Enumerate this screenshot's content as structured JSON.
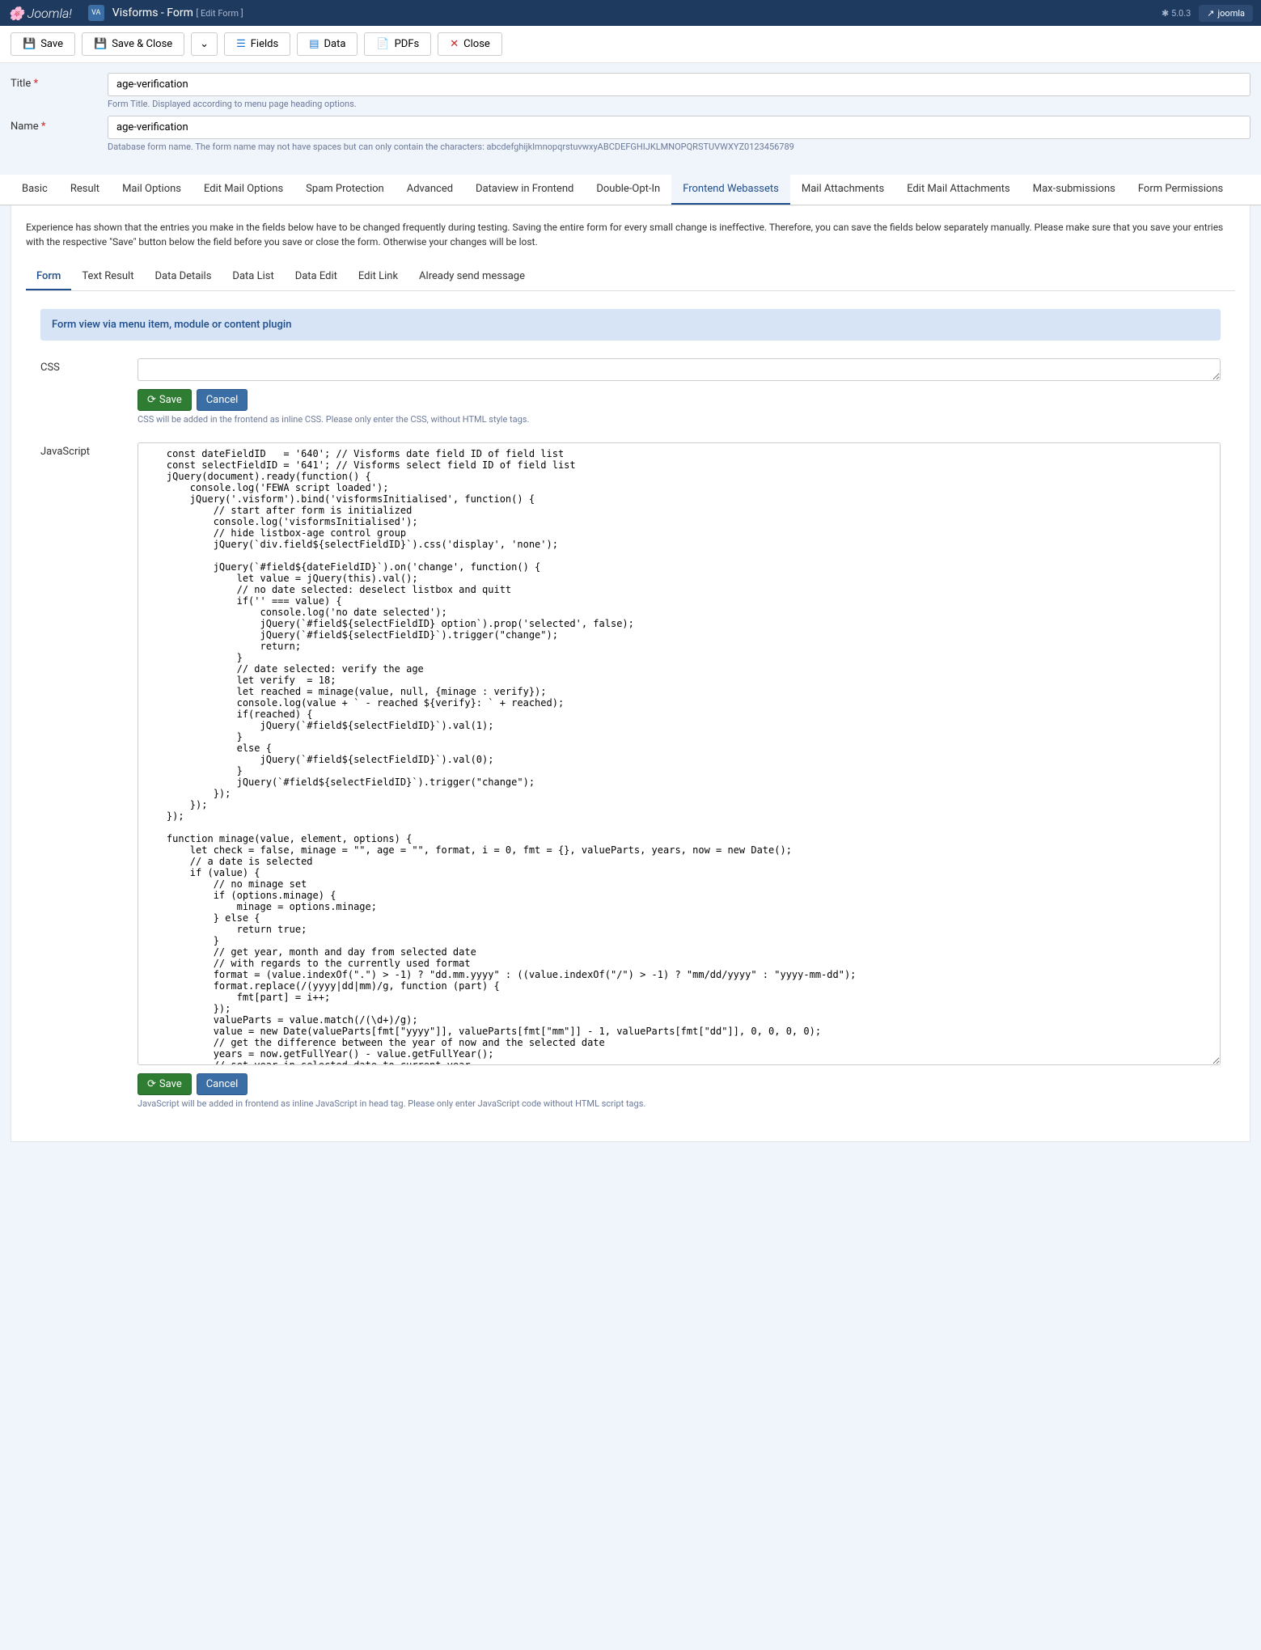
{
  "header": {
    "logo": "Joomla!",
    "appLabel": "VA",
    "breadcrumb": "Visforms - Form",
    "breadcrumbSub": "[ Edit Form ]",
    "version": "5.0.3",
    "user": "joomla"
  },
  "toolbar": {
    "save": "Save",
    "saveClose": "Save & Close",
    "fields": "Fields",
    "data": "Data",
    "pdfs": "PDFs",
    "close": "Close"
  },
  "titleField": {
    "label": "Title",
    "value": "age-verification",
    "help": "Form Title. Displayed according to menu page heading options."
  },
  "nameField": {
    "label": "Name",
    "value": "age-verification",
    "help": "Database form name. The form name may not have spaces but can only contain the characters: abcdefghijklmnopqrstuvwxyABCDEFGHIJKLMNOPQRSTUVWXYZ0123456789"
  },
  "mainTabs": [
    "Basic",
    "Result",
    "Mail Options",
    "Edit Mail Options",
    "Spam Protection",
    "Advanced",
    "Dataview in Frontend",
    "Double-Opt-In",
    "Frontend Webassets",
    "Mail Attachments",
    "Edit Mail Attachments",
    "Max-submissions",
    "Form Permissions"
  ],
  "mainTabActive": 8,
  "notice": "Experience has shown that the entries you make in the fields below have to be changed frequently during testing. Saving the entire form for every small change is ineffective. Therefore, you can save the fields below separately manually. Please make sure that you save your entries with the respective \"Save\" button below the field before you save or close the form. Otherwise your changes will be lost.",
  "subTabs": [
    "Form",
    "Text Result",
    "Data Details",
    "Data List",
    "Data Edit",
    "Edit Link",
    "Already send message"
  ],
  "subTabActive": 0,
  "banner": "Form view via menu item, module or content plugin",
  "cssSection": {
    "label": "CSS",
    "saveBtn": "Save",
    "cancelBtn": "Cancel",
    "help": "CSS will be added in the frontend as inline CSS. Please only enter the CSS, without HTML style tags."
  },
  "jsSection": {
    "label": "JavaScript",
    "saveBtn": "Save",
    "cancelBtn": "Cancel",
    "help": "JavaScript will be added in frontend as inline JavaScript in head tag. Please only enter JavaScript code without HTML script tags.",
    "code": "    const dateFieldID   = '640'; // Visforms date field ID of field list\n    const selectFieldID = '641'; // Visforms select field ID of field list\n    jQuery(document).ready(function() {\n        console.log('FEWA script loaded');\n        jQuery('.visform').bind('visformsInitialised', function() {\n            // start after form is initialized\n            console.log('visformsInitialised');\n            // hide listbox-age control group\n            jQuery(`div.field${selectFieldID}`).css('display', 'none');\n\n            jQuery(`#field${dateFieldID}`).on('change', function() {\n                let value = jQuery(this).val();\n                // no date selected: deselect listbox and quitt\n                if('' === value) {\n                    console.log('no date selected');\n                    jQuery(`#field${selectFieldID} option`).prop('selected', false);\n                    jQuery(`#field${selectFieldID}`).trigger(\"change\");\n                    return;\n                }\n                // date selected: verify the age\n                let verify  = 18;\n                let reached = minage(value, null, {minage : verify});\n                console.log(value + ` - reached ${verify}: ` + reached);\n                if(reached) {\n                    jQuery(`#field${selectFieldID}`).val(1);\n                }\n                else {\n                    jQuery(`#field${selectFieldID}`).val(0);\n                }\n                jQuery(`#field${selectFieldID}`).trigger(\"change\");\n            });\n        });\n    });\n\n    function minage(value, element, options) {\n        let check = false, minage = \"\", age = \"\", format, i = 0, fmt = {}, valueParts, years, now = new Date();\n        // a date is selected\n        if (value) {\n            // no minage set\n            if (options.minage) {\n                minage = options.minage;\n            } else {\n                return true;\n            }\n            // get year, month and day from selected date\n            // with regards to the currently used format\n            format = (value.indexOf(\".\") > -1) ? \"dd.mm.yyyy\" : ((value.indexOf(\"/\") > -1) ? \"mm/dd/yyyy\" : \"yyyy-mm-dd\");\n            format.replace(/(yyyy|dd|mm)/g, function (part) {\n                fmt[part] = i++;\n            });\n            valueParts = value.match(/(\\d+)/g);\n            value = new Date(valueParts[fmt[\"yyyy\"]], valueParts[fmt[\"mm\"]] - 1, valueParts[fmt[\"dd\"]], 0, 0, 0, 0);\n            // get the difference between the year of now and the selected date\n            years = now.getFullYear() - value.getFullYear();\n            // set year in selected date to current year\n            value.setFullYear(value.getFullYear() + years);\n            // if the selected date is then in the future, subtract 1 from years, because the last year is not yet completed\n            if (value > now) {\n                years--;\n            }\n            check = years >= minage;\n            return check;\n        }\n    }"
  }
}
